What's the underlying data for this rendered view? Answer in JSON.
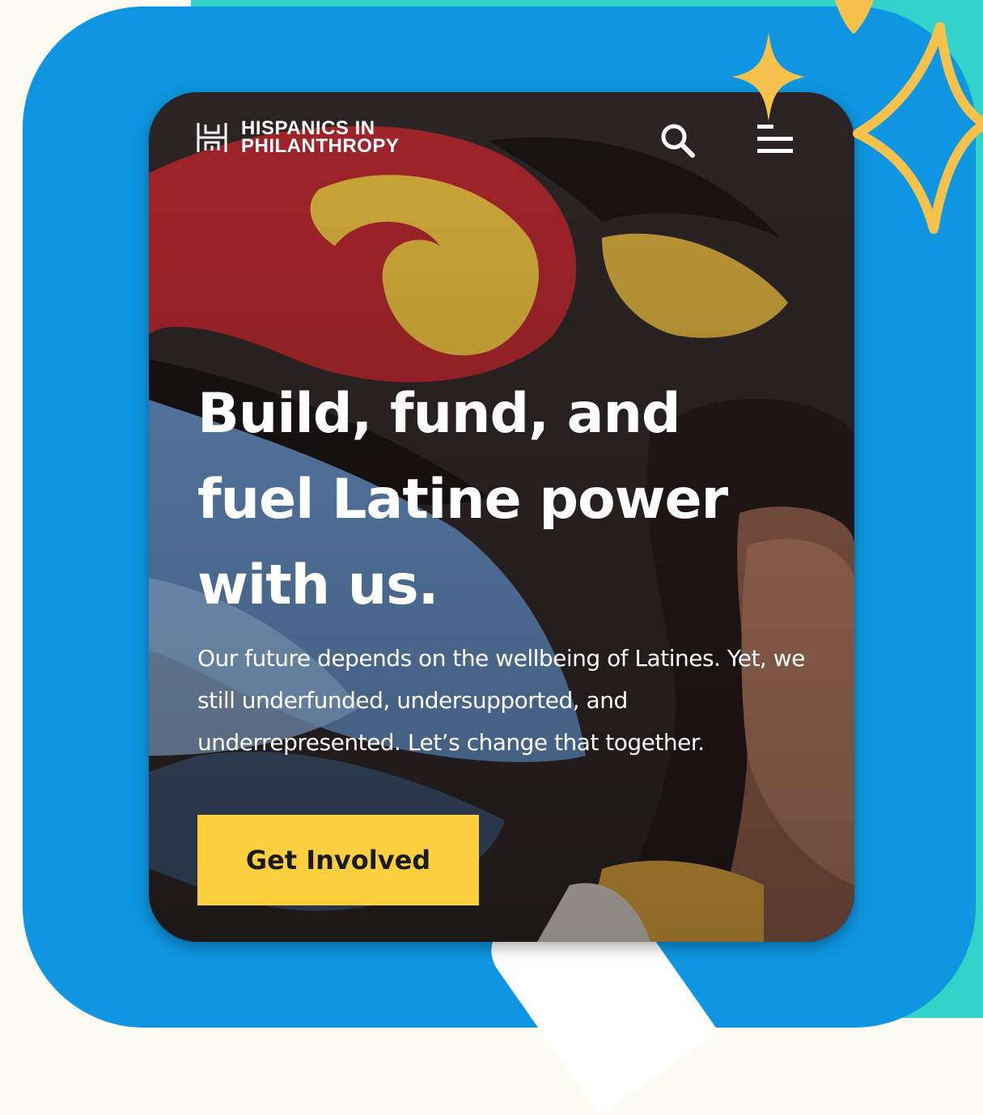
{
  "brand": {
    "name_line1": "HISPANICS IN",
    "name_line2": "PHILANTHROPY"
  },
  "header": {
    "search_icon": "search-icon",
    "menu_icon": "hamburger-menu-icon"
  },
  "hero": {
    "headline": "Build, fund, and fuel Latine power with us.",
    "subtext": "Our future depends on the wellbeing of Latines. Yet, we still underfunded, undersupported, and underrepresented. Let’s change that together.",
    "cta_label": "Get Involved"
  },
  "colors": {
    "page_bg": "#fdfcf3",
    "teal_accent": "#33d3c9",
    "frame_blue": "#0e96e2",
    "cta_yellow": "#fbcf3e",
    "sparkle_gold": "#f6c24b"
  }
}
